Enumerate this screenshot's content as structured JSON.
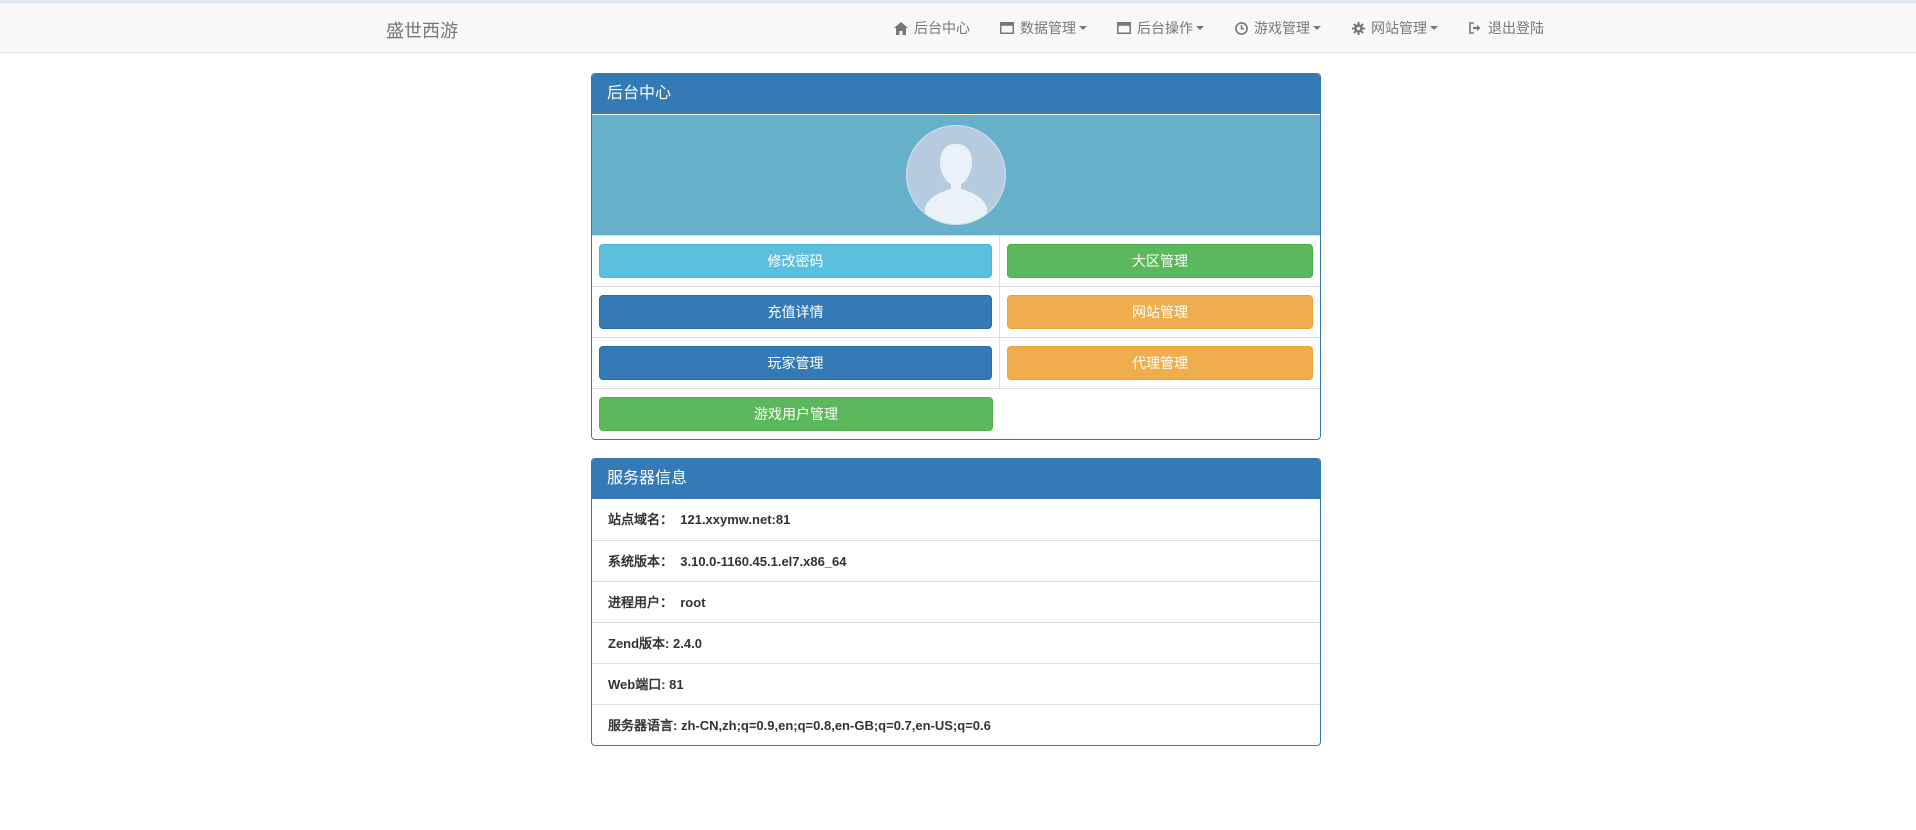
{
  "brand": "盛世西游",
  "nav": [
    {
      "label": "后台中心",
      "icon": "home-icon",
      "dropdown": false
    },
    {
      "label": "数据管理",
      "icon": "window-icon",
      "dropdown": true
    },
    {
      "label": "后台操作",
      "icon": "window-icon",
      "dropdown": true
    },
    {
      "label": "游戏管理",
      "icon": "clock-icon",
      "dropdown": true
    },
    {
      "label": "网站管理",
      "icon": "gear-icon",
      "dropdown": true
    },
    {
      "label": "退出登陆",
      "icon": "logout-icon",
      "dropdown": false
    }
  ],
  "center_panel": {
    "title": "后台中心",
    "buttons": [
      {
        "label": "修改密码",
        "style": "info"
      },
      {
        "label": "大区管理",
        "style": "success"
      },
      {
        "label": "充值详情",
        "style": "primary"
      },
      {
        "label": "网站管理",
        "style": "warning"
      },
      {
        "label": "玩家管理",
        "style": "primary"
      },
      {
        "label": "代理管理",
        "style": "warning"
      },
      {
        "label": "游戏用户管理",
        "style": "success"
      }
    ]
  },
  "server_panel": {
    "title": "服务器信息",
    "rows": [
      {
        "label": "站点域名：",
        "value": "121.xxymw.net:81"
      },
      {
        "label": "系统版本：",
        "value": "3.10.0-1160.45.1.el7.x86_64"
      },
      {
        "label": "进程用户：",
        "value": "root"
      },
      {
        "label": "Zend版本:",
        "value": "2.4.0"
      },
      {
        "label": "Web端口:",
        "value": "81"
      },
      {
        "label": "服务器语言:",
        "value": "zh-CN,zh;q=0.9,en;q=0.8,en-GB;q=0.7,en-US;q=0.6"
      }
    ]
  },
  "colors": {
    "primary": "#337ab7",
    "info": "#5bc0de",
    "success": "#5cb85c",
    "warning": "#f0ad4e",
    "avatar_bg": "#66b1c9"
  }
}
